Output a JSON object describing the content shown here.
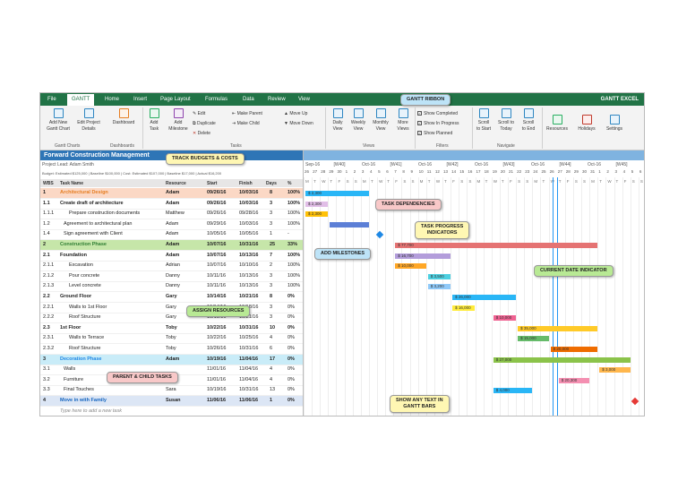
{
  "menu": {
    "tabs": [
      "File",
      "GANTT",
      "Home",
      "Insert",
      "Page Layout",
      "Formulas",
      "Data",
      "Review",
      "View"
    ],
    "brand": "GANTT EXCEL"
  },
  "ribbon": {
    "add_new": "Add New\nGantt Chart",
    "edit_project": "Edit Project\nDetails",
    "dashboard": "Dashboard",
    "add_task": "Add\nTask",
    "add_milestone": "Add\nMilestone",
    "edit": "Edit",
    "duplicate": "Duplicate",
    "delete": "Delete",
    "make_parent": "Make Parent",
    "make_child": "Make Child",
    "move_up": "Move Up",
    "move_down": "Move Down",
    "daily": "Daily\nView",
    "weekly": "Weekly\nView",
    "monthly": "Monthly\nView",
    "more_views": "More\nViews",
    "show_completed": "Show Completed",
    "show_in_progress": "Show In Progress",
    "show_planned": "Show Planned",
    "scroll_start": "Scroll\nto Start",
    "scroll_today": "Scroll to\nToday",
    "scroll_end": "Scroll\nto End",
    "resources": "Resources",
    "holidays": "Holidays",
    "settings": "Settings",
    "groups": {
      "gantt_charts": "Gantt Charts",
      "dashboards": "Dashboards",
      "tasks": "Tasks",
      "views": "Views",
      "filters": "Filters",
      "navigate": "Navigate"
    }
  },
  "project": {
    "title": "Forward Construction Management",
    "lead": "Project Lead: Adam Smith",
    "budget": "Budget: Estimated $125,000 | Baseline $100,000 | Cost: Estimated $107,000 | Baseline $17,000 | Actual $16,200"
  },
  "columns": {
    "wbs": "WBS",
    "task": "Task Name",
    "resource": "Resource",
    "start": "Start",
    "finish": "Finish",
    "days": "Days",
    "pct": "%"
  },
  "tasks": [
    {
      "wbs": "1",
      "name": "Architectural Design",
      "resource": "Adam",
      "start": "09/26/16",
      "finish": "10/03/16",
      "days": "8",
      "pct": "100%",
      "kind": "phase1"
    },
    {
      "wbs": "1.1",
      "name": "Create draft of architecture",
      "resource": "Adam",
      "start": "09/26/16",
      "finish": "10/03/16",
      "days": "3",
      "pct": "100%",
      "kind": "parent"
    },
    {
      "wbs": "1.1.1",
      "name": "Prepare construction documents",
      "resource": "Matthew",
      "start": "09/26/16",
      "finish": "09/28/16",
      "days": "3",
      "pct": "100%",
      "kind": "child"
    },
    {
      "wbs": "1.2",
      "name": "Agreement to architectural plan",
      "resource": "Adam",
      "start": "09/29/16",
      "finish": "10/03/16",
      "days": "3",
      "pct": "100%",
      "kind": "task"
    },
    {
      "wbs": "1.4",
      "name": "Sign agreement with Client",
      "resource": "Adam",
      "start": "10/05/16",
      "finish": "10/05/16",
      "days": "1",
      "pct": "-",
      "kind": "task"
    },
    {
      "wbs": "2",
      "name": "Construction Phase",
      "resource": "Adam",
      "start": "10/07/16",
      "finish": "10/31/16",
      "days": "25",
      "pct": "33%",
      "kind": "phase2"
    },
    {
      "wbs": "2.1",
      "name": "Foundation",
      "resource": "Adam",
      "start": "10/07/16",
      "finish": "10/13/16",
      "days": "7",
      "pct": "100%",
      "kind": "parent"
    },
    {
      "wbs": "2.1.1",
      "name": "Excavation",
      "resource": "Adrian",
      "start": "10/07/16",
      "finish": "10/10/16",
      "days": "2",
      "pct": "100%",
      "kind": "child"
    },
    {
      "wbs": "2.1.2",
      "name": "Pour concrete",
      "resource": "Danny",
      "start": "10/11/16",
      "finish": "10/13/16",
      "days": "3",
      "pct": "100%",
      "kind": "child"
    },
    {
      "wbs": "2.1.3",
      "name": "Level concrete",
      "resource": "Danny",
      "start": "10/11/16",
      "finish": "10/13/16",
      "days": "3",
      "pct": "100%",
      "kind": "child"
    },
    {
      "wbs": "2.2",
      "name": "Ground Floor",
      "resource": "Gary",
      "start": "10/14/16",
      "finish": "10/21/16",
      "days": "8",
      "pct": "0%",
      "kind": "parent"
    },
    {
      "wbs": "2.2.1",
      "name": "Walls to 1st Floor",
      "resource": "Gary",
      "start": "10/14/16",
      "finish": "10/18/16",
      "days": "3",
      "pct": "0%",
      "kind": "child"
    },
    {
      "wbs": "2.2.2",
      "name": "Roof Structure",
      "resource": "Gary",
      "start": "10/19/16",
      "finish": "10/21/16",
      "days": "3",
      "pct": "0%",
      "kind": "child"
    },
    {
      "wbs": "2.3",
      "name": "1st Floor",
      "resource": "Toby",
      "start": "10/22/16",
      "finish": "10/31/16",
      "days": "10",
      "pct": "0%",
      "kind": "parent"
    },
    {
      "wbs": "2.3.1",
      "name": "Walls to Terrace",
      "resource": "Toby",
      "start": "10/22/16",
      "finish": "10/25/16",
      "days": "4",
      "pct": "0%",
      "kind": "child"
    },
    {
      "wbs": "2.3.2",
      "name": "Roof Structure",
      "resource": "Toby",
      "start": "10/26/16",
      "finish": "10/31/16",
      "days": "6",
      "pct": "0%",
      "kind": "child"
    },
    {
      "wbs": "3",
      "name": "Decoration Phase",
      "resource": "Adam",
      "start": "10/19/16",
      "finish": "11/04/16",
      "days": "17",
      "pct": "0%",
      "kind": "phase3"
    },
    {
      "wbs": "3.1",
      "name": "Walls",
      "resource": "",
      "start": "11/01/16",
      "finish": "11/04/16",
      "days": "4",
      "pct": "0%",
      "kind": "task"
    },
    {
      "wbs": "3.2",
      "name": "Furniture",
      "resource": "",
      "start": "11/01/16",
      "finish": "11/04/16",
      "days": "4",
      "pct": "0%",
      "kind": "task"
    },
    {
      "wbs": "3.3",
      "name": "Final Touches",
      "resource": "Sara",
      "start": "10/19/16",
      "finish": "10/31/16",
      "days": "13",
      "pct": "0%",
      "kind": "task"
    },
    {
      "wbs": "4",
      "name": "Move in with Family",
      "resource": "Susan",
      "start": "11/06/16",
      "finish": "11/06/16",
      "days": "1",
      "pct": "0%",
      "kind": "phase4"
    }
  ],
  "add_task_hint": "Type here to add a new task",
  "timeline": {
    "week_labels": [
      "Sep-16",
      "[W40]",
      "Oct-16",
      "[W41]",
      "Oct-16",
      "[W42]",
      "Oct-16",
      "[W43]",
      "Oct-16",
      "[W44]",
      "Oct-16",
      "[W45]"
    ],
    "days": [
      "26",
      "27",
      "28",
      "29",
      "30",
      "1",
      "2",
      "3",
      "4",
      "5",
      "6",
      "7",
      "8",
      "9",
      "10",
      "11",
      "12",
      "13",
      "14",
      "15",
      "16",
      "17",
      "18",
      "19",
      "20",
      "21",
      "22",
      "23",
      "24",
      "25",
      "26",
      "27",
      "28",
      "29",
      "30",
      "31",
      "1",
      "2",
      "3",
      "4",
      "5",
      "6"
    ],
    "dow": [
      "M",
      "T",
      "W",
      "T",
      "F",
      "S",
      "S",
      "M",
      "T",
      "W",
      "T",
      "F",
      "S",
      "S",
      "M",
      "T",
      "W",
      "T",
      "F",
      "S",
      "S",
      "M",
      "T",
      "W",
      "T",
      "F",
      "S",
      "S",
      "M",
      "T",
      "W",
      "T",
      "F",
      "S",
      "S",
      "M",
      "T",
      "W",
      "T",
      "F",
      "S",
      "S"
    ]
  },
  "bars": [
    {
      "row": 0,
      "label": "$ 2,300",
      "color": "#29b6f6",
      "start": 0,
      "len": 8
    },
    {
      "row": 1,
      "label": "$ 2,300",
      "color": "#e1bee7",
      "start": 0,
      "len": 3
    },
    {
      "row": 2,
      "label": "$ 2,300",
      "color": "#ffc107",
      "start": 0,
      "len": 3
    },
    {
      "row": 3,
      "label": "",
      "color": "#5c7fd6",
      "start": 3,
      "len": 5
    },
    {
      "row": 5,
      "label": "$ 77,700",
      "color": "#e57373",
      "start": 11,
      "len": 25
    },
    {
      "row": 6,
      "label": "$ 16,700",
      "color": "#b39ddb",
      "start": 11,
      "len": 7
    },
    {
      "row": 7,
      "label": "$ 10,000",
      "color": "#ffa726",
      "start": 11,
      "len": 4
    },
    {
      "row": 8,
      "label": "$ 3,500",
      "color": "#4dd0e1",
      "start": 15,
      "len": 3
    },
    {
      "row": 9,
      "label": "$ 3,200",
      "color": "#90caf9",
      "start": 15,
      "len": 3
    },
    {
      "row": 10,
      "label": "$ 26,000",
      "color": "#29b6f6",
      "start": 18,
      "len": 8
    },
    {
      "row": 11,
      "label": "$ 16,000",
      "color": "#ffeb3b",
      "start": 18,
      "len": 3
    },
    {
      "row": 12,
      "label": "$ 10,000",
      "color": "#f06292",
      "start": 23,
      "len": 3
    },
    {
      "row": 13,
      "label": "$ 35,000",
      "color": "#ffca28",
      "start": 26,
      "len": 10
    },
    {
      "row": 14,
      "label": "$ 15,000",
      "color": "#66bb6a",
      "start": 26,
      "len": 4
    },
    {
      "row": 15,
      "label": "$ 20,000",
      "color": "#ef6c00",
      "start": 30,
      "len": 6
    },
    {
      "row": 16,
      "label": "$ 27,000",
      "color": "#8bc34a",
      "start": 23,
      "len": 17
    },
    {
      "row": 17,
      "label": "$ 3,000",
      "color": "#ffb74d",
      "start": 36,
      "len": 4
    },
    {
      "row": 18,
      "label": "$ 20,300",
      "color": "#f48fb1",
      "start": 31,
      "len": 4
    },
    {
      "row": 19,
      "label": "$ 4,000",
      "color": "#29b6f6",
      "start": 23,
      "len": 5
    }
  ],
  "callouts": {
    "ribbon": "GANTT RIBBON",
    "track": "TRACK BUDGETS & COSTS",
    "deps": "TASK DEPENDENCIES",
    "progress": "TASK PROGRESS\nINDICATORS",
    "milestones": "ADD MILESTONES",
    "current_date": "CURRENT DATE INDICATOR",
    "resources": "ASSIGN RESOURCES",
    "parent_child": "PARENT & CHILD TASKS",
    "text_bars": "SHOW ANY TEXT IN\nGANTT BARS"
  },
  "colors": {
    "excel_green": "#217346",
    "title_blue": "#2e75b6",
    "phase1": "#fbd8c5",
    "phase2": "#c6e6a9",
    "phase3": "#c9ecf8",
    "phase4": "#dce6f5"
  }
}
